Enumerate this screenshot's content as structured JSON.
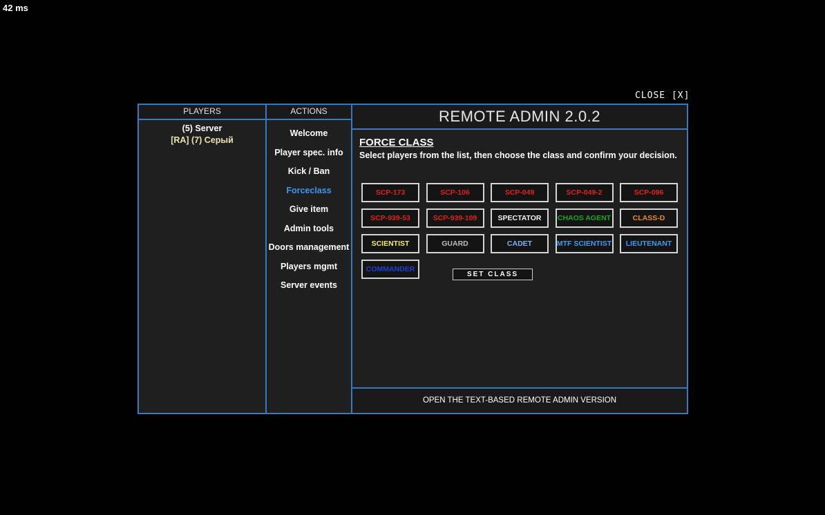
{
  "ping": "42 ms",
  "close_label": "CLOSE [X]",
  "players_panel": {
    "header": "PLAYERS",
    "items": [
      "(5) Server",
      "[RA] (7) Серый"
    ]
  },
  "actions_panel": {
    "header": "ACTIONS",
    "items": [
      "Welcome",
      "Player spec. info",
      "Kick / Ban",
      "Forceclass",
      "Give item",
      "Admin tools",
      "Doors management",
      "Players mgmt",
      "Server events"
    ],
    "active": "Forceclass"
  },
  "main": {
    "title": "REMOTE ADMIN 2.0.2",
    "section_title": "FORCE CLASS",
    "description": "Select players from the list, then choose the class and confirm your decision.",
    "classes": [
      {
        "label": "SCP-173",
        "color": "#e0201c"
      },
      {
        "label": "SCP-106",
        "color": "#e0201c"
      },
      {
        "label": "SCP-049",
        "color": "#e0201c"
      },
      {
        "label": "SCP-049-2",
        "color": "#e0201c"
      },
      {
        "label": "SCP-096",
        "color": "#e0201c"
      },
      {
        "label": "SCP-939-53",
        "color": "#e0201c"
      },
      {
        "label": "SCP-939-109",
        "color": "#e0201c"
      },
      {
        "label": "SPECTATOR",
        "color": "#f2f2f2"
      },
      {
        "label": "CHAOS AGENT",
        "color": "#17a52a"
      },
      {
        "label": "CLASS-D",
        "color": "#f08c1a"
      },
      {
        "label": "SCIENTIST",
        "color": "#f2ec6a"
      },
      {
        "label": "GUARD",
        "color": "#bdbdbd"
      },
      {
        "label": "CADET",
        "color": "#79b6f5"
      },
      {
        "label": "MTF SCIENTIST",
        "color": "#3a9cf5"
      },
      {
        "label": "LIEUTENANT",
        "color": "#3a9cf5"
      },
      {
        "label": "COMMANDER",
        "color": "#1d3fd8"
      }
    ],
    "set_class_label": "SET CLASS",
    "footer_link": "OPEN THE TEXT-BASED REMOTE ADMIN VERSION"
  }
}
